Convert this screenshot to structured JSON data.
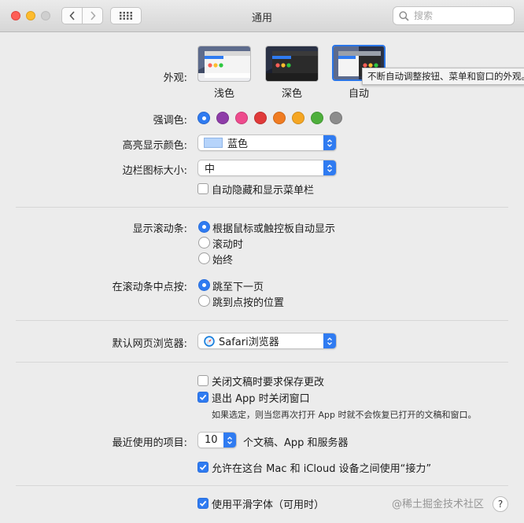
{
  "window": {
    "title": "通用"
  },
  "search": {
    "placeholder": "搜索"
  },
  "appearance": {
    "label": "外观:",
    "options": [
      {
        "name": "浅色",
        "selected": false
      },
      {
        "name": "深色",
        "selected": false
      },
      {
        "name": "自动",
        "selected": true
      }
    ],
    "tooltip": "不断自动调整按钮、菜单和窗口的外观。"
  },
  "accent": {
    "label": "强调色:",
    "colors": [
      "#2f7bf1",
      "#8e3ca8",
      "#ee4b8d",
      "#e03a3a",
      "#f07c22",
      "#f5a623",
      "#4eaf3c",
      "#8c8c8c"
    ],
    "selected_index": 0
  },
  "highlight": {
    "label": "高亮显示颜色:",
    "value": "蓝色",
    "swatch": "#b6d4fb"
  },
  "sidebar_icon": {
    "label": "边栏图标大小:",
    "value": "中"
  },
  "autohide_menubar": {
    "label": "自动隐藏和显示菜单栏",
    "checked": false
  },
  "scrollbars": {
    "label": "显示滚动条:",
    "options": [
      "根据鼠标或触控板自动显示",
      "滚动时",
      "始终"
    ],
    "selected_index": 0
  },
  "scroll_click": {
    "label": "在滚动条中点按:",
    "options": [
      "跳至下一页",
      "跳到点按的位置"
    ],
    "selected_index": 0
  },
  "browser": {
    "label": "默认网页浏览器:",
    "value": "Safari浏览器"
  },
  "close_docs": {
    "ask_save": {
      "label": "关闭文稿时要求保存更改",
      "checked": false
    },
    "close_windows": {
      "label": "退出 App 时关闭窗口",
      "checked": true
    },
    "note": "如果选定，则当您再次打开 App 时就不会恢复已打开的文稿和窗口。"
  },
  "recent_items": {
    "label": "最近使用的项目:",
    "value": "10",
    "suffix": "个文稿、App 和服务器"
  },
  "handoff": {
    "label": "允许在这台 Mac 和 iCloud 设备之间使用“接力”",
    "checked": true
  },
  "font_smoothing": {
    "label": "使用平滑字体（可用时）",
    "checked": true
  },
  "help_label": "?",
  "watermark": "@稀土掘金技术社区"
}
